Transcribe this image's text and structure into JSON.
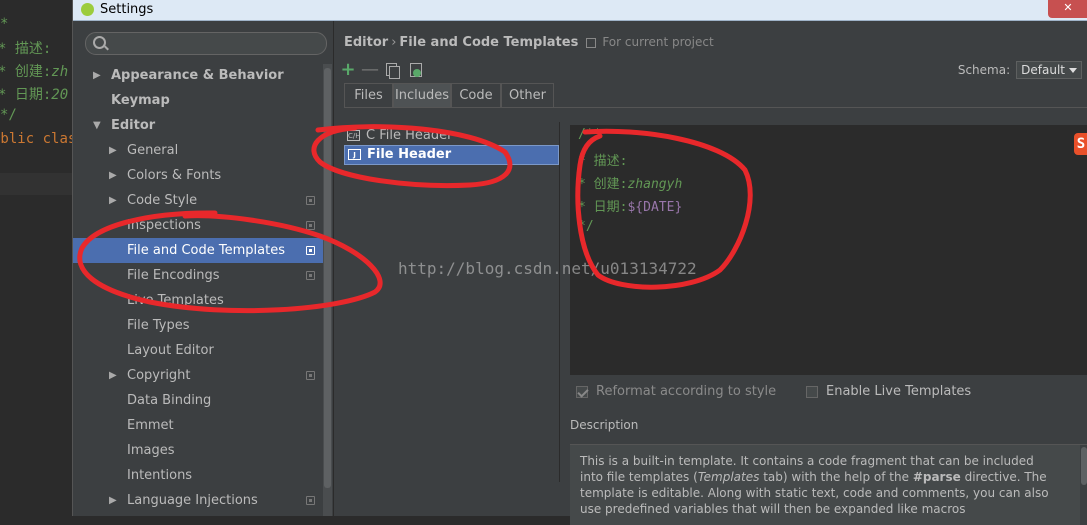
{
  "background_editor": {
    "lines": [
      "*",
      "* 描述:",
      "* 创建:",
      "zh",
      "* 日期:",
      "20",
      "*/",
      "ublic",
      "class"
    ]
  },
  "window": {
    "title": "Settings",
    "close_label": "✕"
  },
  "search": {
    "value": "",
    "placeholder": ""
  },
  "tree": [
    {
      "label": "Appearance & Behavior",
      "level": 0,
      "arrow": "▶",
      "bold": true,
      "project": false
    },
    {
      "label": "Keymap",
      "level": 0,
      "arrow": "",
      "bold": true,
      "project": false
    },
    {
      "label": "Editor",
      "level": 0,
      "arrow": "▼",
      "bold": true,
      "project": false
    },
    {
      "label": "General",
      "level": 1,
      "arrow": "▶",
      "bold": false,
      "project": false
    },
    {
      "label": "Colors & Fonts",
      "level": 1,
      "arrow": "▶",
      "bold": false,
      "project": false
    },
    {
      "label": "Code Style",
      "level": 1,
      "arrow": "▶",
      "bold": false,
      "project": true
    },
    {
      "label": "Inspections",
      "level": 1,
      "arrow": "",
      "bold": false,
      "project": true
    },
    {
      "label": "File and Code Templates",
      "level": 1,
      "arrow": "",
      "bold": false,
      "project": true,
      "selected": true
    },
    {
      "label": "File Encodings",
      "level": 1,
      "arrow": "",
      "bold": false,
      "project": true
    },
    {
      "label": "Live Templates",
      "level": 1,
      "arrow": "",
      "bold": false,
      "project": false
    },
    {
      "label": "File Types",
      "level": 1,
      "arrow": "",
      "bold": false,
      "project": false
    },
    {
      "label": "Layout Editor",
      "level": 1,
      "arrow": "",
      "bold": false,
      "project": false
    },
    {
      "label": "Copyright",
      "level": 1,
      "arrow": "▶",
      "bold": false,
      "project": true
    },
    {
      "label": "Data Binding",
      "level": 1,
      "arrow": "",
      "bold": false,
      "project": false
    },
    {
      "label": "Emmet",
      "level": 1,
      "arrow": "",
      "bold": false,
      "project": false
    },
    {
      "label": "Images",
      "level": 1,
      "arrow": "",
      "bold": false,
      "project": false
    },
    {
      "label": "Intentions",
      "level": 1,
      "arrow": "",
      "bold": false,
      "project": false
    },
    {
      "label": "Language Injections",
      "level": 1,
      "arrow": "▶",
      "bold": false,
      "project": true
    }
  ],
  "breadcrumb": {
    "part1": "Editor",
    "separator": "›",
    "part2": "File and Code Templates",
    "scope": "For current project"
  },
  "toolbar": {
    "add": "+",
    "remove": "—"
  },
  "schema": {
    "label": "Schema:",
    "value": "Default"
  },
  "tabs": [
    {
      "label": "Files",
      "active": false
    },
    {
      "label": "Includes",
      "active": true
    },
    {
      "label": "Code",
      "active": false
    },
    {
      "label": "Other",
      "active": false
    }
  ],
  "templates": [
    {
      "label": "C File Header",
      "icon": "C/H",
      "selected": false
    },
    {
      "label": "File Header",
      "icon": "J",
      "selected": true
    }
  ],
  "code": {
    "l1": "/**",
    "l2": "* 描述:",
    "l3_prefix": "* 创建:",
    "l3_name": "zhangyh",
    "l4_prefix": "* 日期:",
    "l4_var": "${DATE}",
    "l5": "*/",
    "logo": "S"
  },
  "options": {
    "reformat": "Reformat according to style",
    "reformat_checked": true,
    "live": "Enable Live Templates",
    "live_checked": false
  },
  "description": {
    "label": "Description",
    "text_1": "This is a built-in template. It contains a code fragment that can be included into file templates (",
    "text_2": "Templates",
    "text_3": " tab) with the help of the ",
    "text_4": "#parse",
    "text_5": " directive. The template is editable. Along with static text, code and comments, you can also use predefined variables that will then be expanded like macros"
  },
  "watermark": "http://blog.csdn.net/u013134722",
  "colors": {
    "selection": "#4b6eaf",
    "comment": "#629755",
    "variable": "#9876aa",
    "annotation": "#e8282b"
  }
}
